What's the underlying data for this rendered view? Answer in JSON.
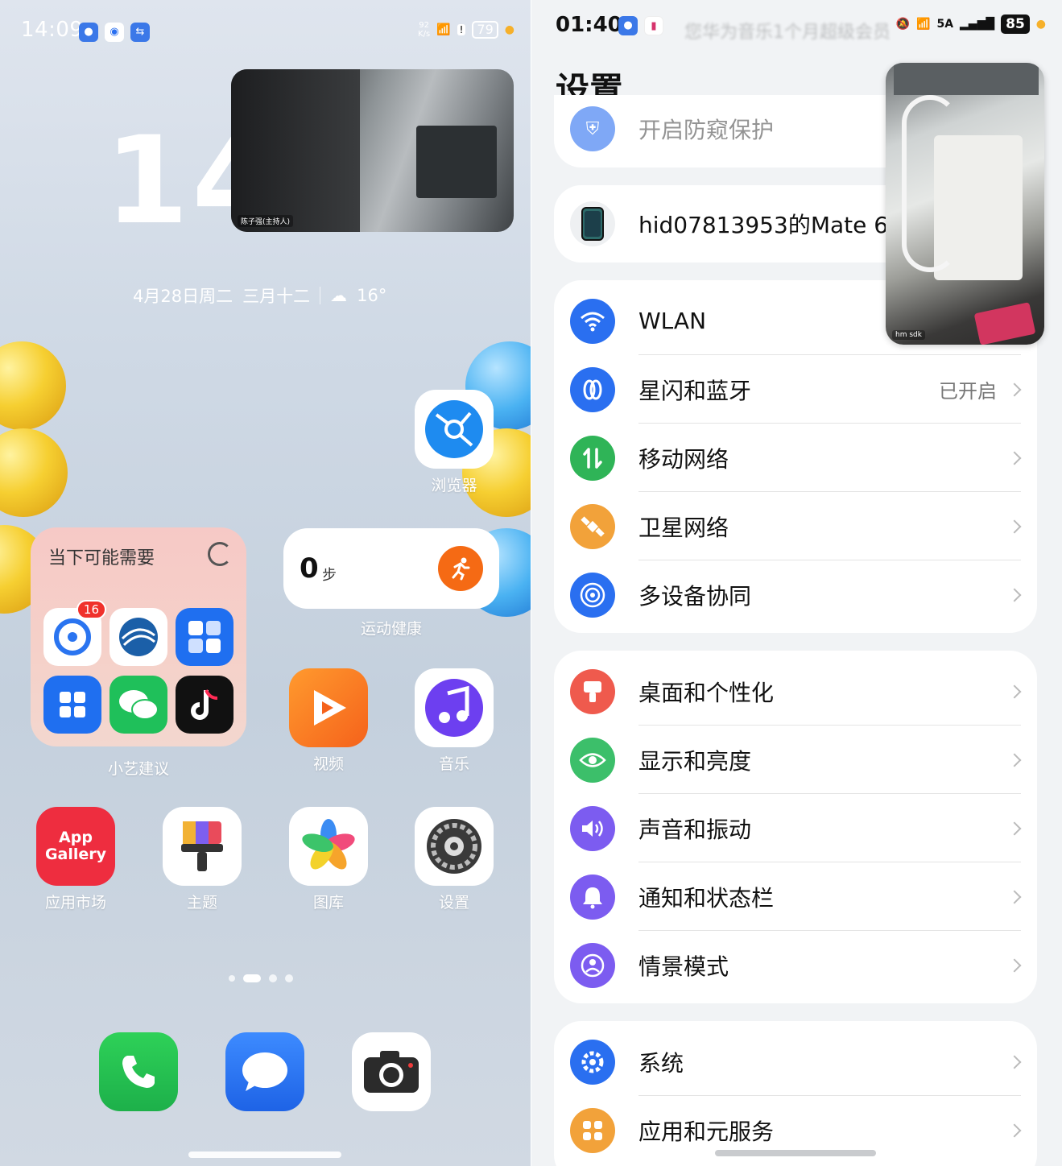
{
  "left": {
    "status": {
      "time": "14:09",
      "net_speed": "92\nK/s",
      "battery": "79"
    },
    "big_clock": "14:0",
    "date_line": {
      "date": "4月28日周二",
      "lunar": "三月十二",
      "temp": "16°"
    },
    "video_label": "陈子强(主持人)",
    "browser": {
      "label": "浏览器"
    },
    "suggest": {
      "title": "当下可能需要",
      "footer": "小艺建议",
      "badge": "16"
    },
    "steps": {
      "value": "0",
      "unit": "步",
      "label": "运动健康"
    },
    "apps_row1": [
      {
        "label": "视频"
      },
      {
        "label": "音乐"
      }
    ],
    "apps_row2": [
      {
        "label": "应用市场",
        "icon_text": "App Gallery"
      },
      {
        "label": "主题"
      },
      {
        "label": "图库"
      },
      {
        "label": "设置"
      }
    ]
  },
  "right": {
    "status": {
      "time": "01:40",
      "banner": "您华为音乐1个月超级会员",
      "signal": "5A",
      "battery": "85"
    },
    "title": "设置",
    "peek_item": "开启防窥保护",
    "device_name": "hid07813953的Mate 60",
    "video_label": "hm sdk",
    "group1": [
      {
        "label": "WLAN",
        "icon": "wifi-icon",
        "color": "#2a6ff0",
        "value": ""
      },
      {
        "label": "星闪和蓝牙",
        "icon": "bluetooth-icon",
        "color": "#2a6ff0",
        "value": "已开启"
      },
      {
        "label": "移动网络",
        "icon": "mobile-data-icon",
        "color": "#2fb457",
        "value": ""
      },
      {
        "label": "卫星网络",
        "icon": "satellite-icon",
        "color": "#f2a23a",
        "value": ""
      },
      {
        "label": "多设备协同",
        "icon": "multi-device-icon",
        "color": "#2a6ff0",
        "value": ""
      }
    ],
    "group2": [
      {
        "label": "桌面和个性化",
        "icon": "brush-icon",
        "color": "#ef5a4d"
      },
      {
        "label": "显示和亮度",
        "icon": "eye-icon",
        "color": "#3cbf6a"
      },
      {
        "label": "声音和振动",
        "icon": "speaker-icon",
        "color": "#7c5cf0"
      },
      {
        "label": "通知和状态栏",
        "icon": "bell-icon",
        "color": "#7c5cf0"
      },
      {
        "label": "情景模式",
        "icon": "scene-icon",
        "color": "#7c5cf0"
      }
    ],
    "group3": [
      {
        "label": "系统",
        "icon": "gear-icon",
        "color": "#2a6ff0"
      },
      {
        "label": "应用和元服务",
        "icon": "apps-icon",
        "color": "#f2a23a"
      }
    ]
  }
}
